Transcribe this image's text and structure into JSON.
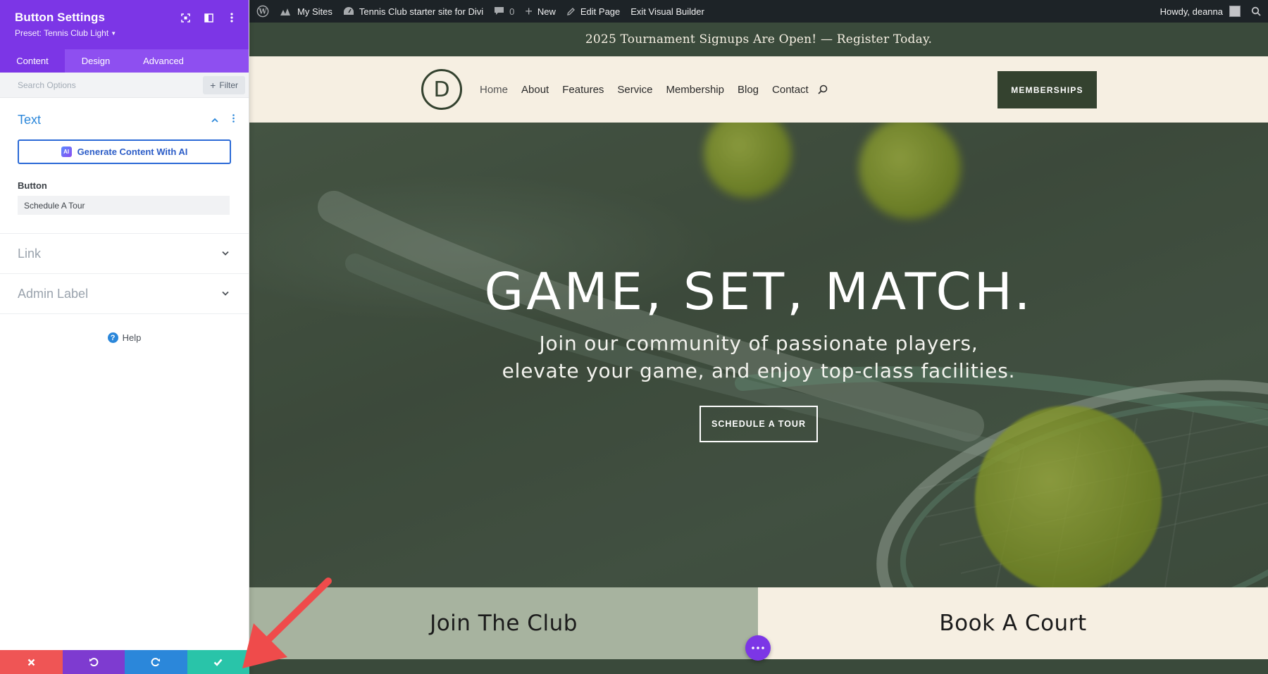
{
  "adminbar": {
    "my_sites": "My Sites",
    "site_name": "Tennis Club starter site for Divi",
    "comments_count": "0",
    "new_label": "New",
    "edit_page": "Edit Page",
    "exit_builder": "Exit Visual Builder",
    "howdy": "Howdy, deanna"
  },
  "panel": {
    "title": "Button Settings",
    "preset": "Preset: Tennis Club Light",
    "tabs": [
      {
        "label": "Content"
      },
      {
        "label": "Design"
      },
      {
        "label": "Advanced"
      }
    ],
    "search_placeholder": "Search Options",
    "filter_label": "Filter",
    "text_toggle": {
      "title": "Text",
      "ai_button": "Generate Content With AI",
      "ai_badge": "AI",
      "button_field_label": "Button",
      "button_field_value": "Schedule A Tour"
    },
    "link_toggle": "Link",
    "admin_label_toggle": "Admin Label",
    "help": "Help",
    "footer": {
      "discard_color": "#ef5555",
      "undo_color": "#7e3bd0",
      "redo_color": "#2b87da",
      "save_color": "#29c4a9"
    }
  },
  "site": {
    "promo": "2025 Tournament Signups Are Open! — Register Today.",
    "logo_letter": "D",
    "menu": [
      {
        "label": "Home"
      },
      {
        "label": "About"
      },
      {
        "label": "Features"
      },
      {
        "label": "Service"
      },
      {
        "label": "Membership"
      },
      {
        "label": "Blog"
      },
      {
        "label": "Contact"
      }
    ],
    "memberships_btn": "MEMBERSHIPS",
    "hero": {
      "title": "GAME, SET, MATCH.",
      "subtitle_line1": "Join our community of passionate players,",
      "subtitle_line2": "elevate your game, and enjoy top-class facilities.",
      "cta": "SCHEDULE A TOUR"
    },
    "cta_join": "Join The Club",
    "cta_book": "Book A Court"
  },
  "colors": {
    "divi_purple": "#7c36e6",
    "brand_green": "#34422f",
    "cream": "#f6efe2",
    "annotation_red": "#ef4b4b"
  }
}
